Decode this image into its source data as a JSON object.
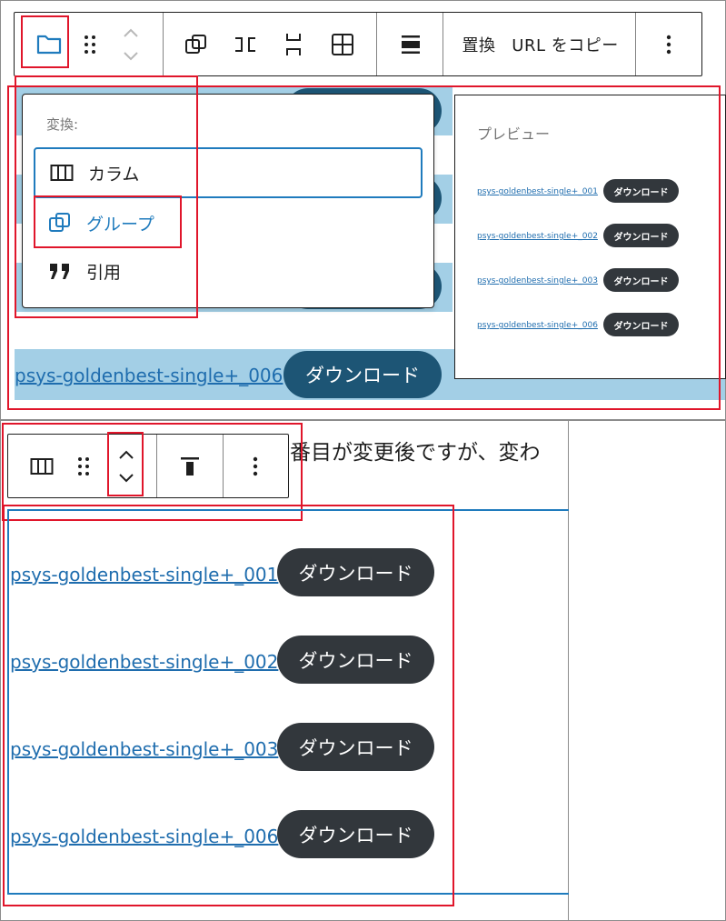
{
  "toolbar": {
    "replace_label": "置換",
    "copy_url_label": "URL をコピー"
  },
  "transform_menu": {
    "heading": "変換:",
    "items": [
      {
        "label": "カラム",
        "icon": "columns-icon"
      },
      {
        "label": "グループ",
        "icon": "group-icon"
      },
      {
        "label": "引用",
        "icon": "quote-icon"
      }
    ]
  },
  "preview": {
    "title": "プレビュー",
    "rows": [
      {
        "link": "psys-goldenbest-single+_001",
        "button": "ダウンロード"
      },
      {
        "link": "psys-goldenbest-single+_002",
        "button": "ダウンロード"
      },
      {
        "link": "psys-goldenbest-single+_003",
        "button": "ダウンロード"
      },
      {
        "link": "psys-goldenbest-single+_006",
        "button": "ダウンロード"
      }
    ]
  },
  "selected_block": {
    "last_row_link": "psys-goldenbest-single+_006",
    "last_row_button": "ダウンロード"
  },
  "paragraph_fragment": "番目が変更後ですが、変わ",
  "columns": {
    "rows": [
      {
        "link": "psys-goldenbest-single+_001",
        "button": "ダウンロード"
      },
      {
        "link": "psys-goldenbest-single+_002",
        "button": "ダウンロード"
      },
      {
        "link": "psys-goldenbest-single+_003",
        "button": "ダウンロード"
      },
      {
        "link": "psys-goldenbest-single+_006",
        "button": "ダウンロード"
      }
    ]
  },
  "colors": {
    "highlight": "#e0162b",
    "selection_band": "#a3cfe6",
    "accent_blue": "#1f7bbd",
    "dark_button": "#32373c",
    "selected_button": "#1d5575"
  }
}
